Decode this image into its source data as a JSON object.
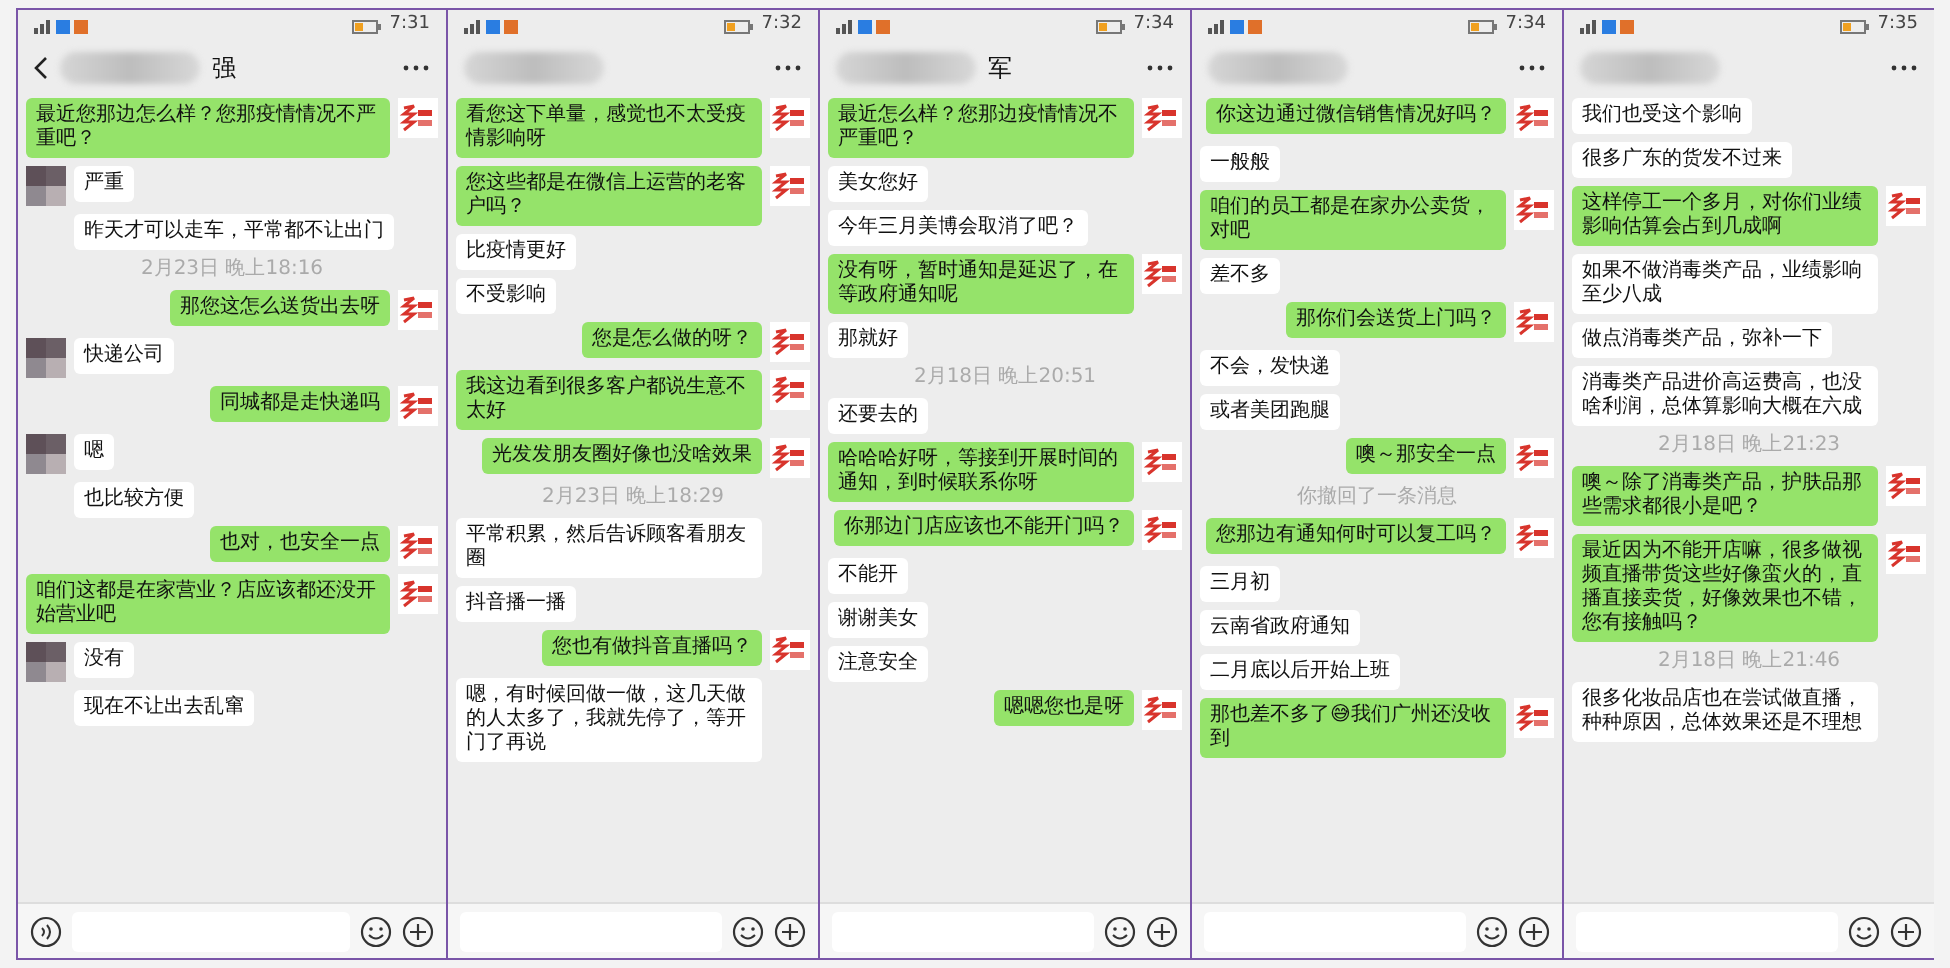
{
  "panels": [
    {
      "status_time": "7:31",
      "back_button": true,
      "name_visible": "强",
      "voice_button": true,
      "messages": [
        {
          "kind": "sent",
          "text": "最近您那边怎么样？您那疫情情况不严重吧？"
        },
        {
          "kind": "received",
          "text": "严重",
          "avatar": true
        },
        {
          "kind": "received",
          "text": "昨天才可以走车，平常都不让出门",
          "avatar": false
        },
        {
          "kind": "time",
          "text": "2月23日 晚上18:16"
        },
        {
          "kind": "sent",
          "text": "那您这怎么送货出去呀"
        },
        {
          "kind": "received",
          "text": "快递公司",
          "avatar": true
        },
        {
          "kind": "sent",
          "text": "同城都是走快递吗"
        },
        {
          "kind": "received",
          "text": "嗯",
          "avatar": true
        },
        {
          "kind": "received",
          "text": "也比较方便",
          "avatar": false
        },
        {
          "kind": "sent",
          "text": "也对，也安全一点"
        },
        {
          "kind": "sent",
          "text": "咱们这都是在家营业？店应该都还没开始营业吧"
        },
        {
          "kind": "received",
          "text": "没有",
          "avatar": true
        },
        {
          "kind": "received",
          "text": "现在不让出去乱窜",
          "avatar": false
        }
      ]
    },
    {
      "status_time": "7:32",
      "back_button": false,
      "voice_button": false,
      "messages": [
        {
          "kind": "sent",
          "text": "看您这下单量，感觉也不太受疫情影响呀"
        },
        {
          "kind": "sent",
          "text": "您这些都是在微信上运营的老客户吗？"
        },
        {
          "kind": "received",
          "text": "比疫情更好"
        },
        {
          "kind": "received",
          "text": "不受影响"
        },
        {
          "kind": "sent",
          "text": "您是怎么做的呀？"
        },
        {
          "kind": "sent",
          "text": "我这边看到很多客户都说生意不太好"
        },
        {
          "kind": "sent",
          "text": "光发发朋友圈好像也没啥效果"
        },
        {
          "kind": "time",
          "text": "2月23日 晚上18:29"
        },
        {
          "kind": "received",
          "text": "平常积累，然后告诉顾客看朋友圈"
        },
        {
          "kind": "received",
          "text": "抖音播一播"
        },
        {
          "kind": "sent",
          "text": "您也有做抖音直播吗？"
        },
        {
          "kind": "received",
          "text": "嗯，有时候回做一做，这几天做的人太多了，我就先停了，等开门了再说"
        }
      ]
    },
    {
      "status_time": "7:34",
      "back_button": false,
      "name_visible": "军",
      "voice_button": false,
      "messages": [
        {
          "kind": "sent",
          "text": "最近怎么样？您那边疫情情况不严重吧？"
        },
        {
          "kind": "received",
          "text": "美女您好"
        },
        {
          "kind": "received",
          "text": "今年三月美博会取消了吧？"
        },
        {
          "kind": "sent",
          "text": "没有呀，暂时通知是延迟了，在等政府通知呢"
        },
        {
          "kind": "received",
          "text": "那就好"
        },
        {
          "kind": "time",
          "text": "2月18日 晚上20:51"
        },
        {
          "kind": "received",
          "text": "还要去的"
        },
        {
          "kind": "sent",
          "text": "哈哈哈好呀，等接到开展时间的通知，到时候联系你呀"
        },
        {
          "kind": "sent",
          "text": "你那边门店应该也不能开门吗？"
        },
        {
          "kind": "received",
          "text": "不能开"
        },
        {
          "kind": "received",
          "text": "谢谢美女"
        },
        {
          "kind": "received",
          "text": "注意安全"
        },
        {
          "kind": "sent",
          "text": "嗯嗯您也是呀"
        }
      ]
    },
    {
      "status_time": "7:34",
      "back_button": false,
      "voice_button": false,
      "messages": [
        {
          "kind": "sent",
          "text": "你这边通过微信销售情况好吗？"
        },
        {
          "kind": "received",
          "text": "一般般"
        },
        {
          "kind": "sent",
          "text": "咱们的员工都是在家办公卖货，对吧"
        },
        {
          "kind": "received",
          "text": "差不多"
        },
        {
          "kind": "sent",
          "text": "那你们会送货上门吗？"
        },
        {
          "kind": "received",
          "text": "不会，发快递"
        },
        {
          "kind": "received",
          "text": "或者美团跑腿"
        },
        {
          "kind": "sent",
          "text": "噢～那安全一点"
        },
        {
          "kind": "time",
          "text": "你撤回了一条消息"
        },
        {
          "kind": "sent",
          "text": "您那边有通知何时可以复工吗？"
        },
        {
          "kind": "received",
          "text": "三月初"
        },
        {
          "kind": "received",
          "text": "云南省政府通知"
        },
        {
          "kind": "received",
          "text": "二月底以后开始上班"
        },
        {
          "kind": "sent",
          "text": "那也差不多了😅我们广州还没收到"
        }
      ]
    },
    {
      "status_time": "7:35",
      "back_button": false,
      "voice_button": false,
      "messages": [
        {
          "kind": "received",
          "text": "我们也受这个影响"
        },
        {
          "kind": "received",
          "text": "很多广东的货发不过来"
        },
        {
          "kind": "sent",
          "text": "这样停工一个多月，对你们业绩影响估算会占到几成啊"
        },
        {
          "kind": "received",
          "text": "如果不做消毒类产品，业绩影响至少八成"
        },
        {
          "kind": "received",
          "text": "做点消毒类产品，弥补一下"
        },
        {
          "kind": "received",
          "text": "消毒类产品进价高运费高，也没啥利润，总体算影响大概在六成"
        },
        {
          "kind": "time",
          "text": "2月18日 晚上21:23"
        },
        {
          "kind": "sent",
          "text": "噢～除了消毒类产品，护肤品那些需求都很小是吧？"
        },
        {
          "kind": "sent",
          "text": "最近因为不能开店嘛，很多做视频直播带货这些好像蛮火的，直播直接卖货，好像效果也不错，您有接触吗？"
        },
        {
          "kind": "time",
          "text": "2月18日 晚上21:46"
        },
        {
          "kind": "received",
          "text": "很多化妆品店也在尝试做直播，种种原因，总体效果还是不理想"
        }
      ]
    }
  ]
}
